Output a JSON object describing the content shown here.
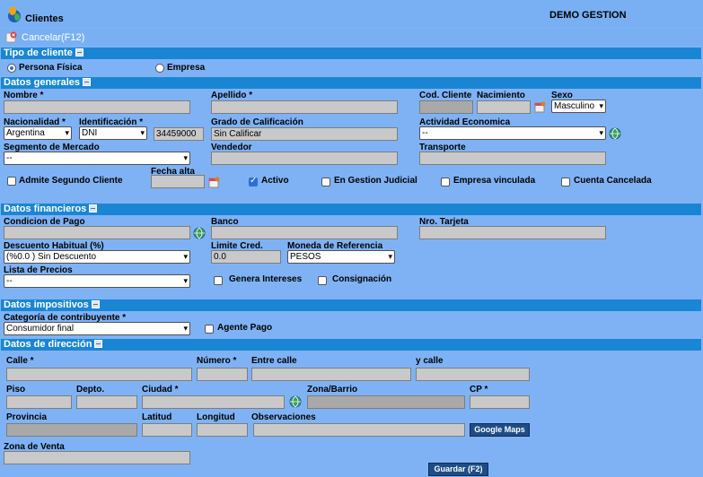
{
  "header": {
    "title": "Clientes",
    "company": "DEMO GESTION",
    "cancel_label": "Cancelar(F12)"
  },
  "tipo": {
    "title": "Tipo de cliente",
    "persona_fisica": "Persona Física",
    "empresa": "Empresa"
  },
  "generales": {
    "title": "Datos generales",
    "nombre_label": "Nombre *",
    "apellido_label": "Apellido *",
    "cod_cliente_label": "Cod. Cliente",
    "nacimiento_label": "Nacimiento",
    "sexo_label": "Sexo",
    "sexo_value": "Masculino",
    "nacionalidad_label": "Nacionalidad *",
    "nacionalidad_value": "Argentina",
    "identificacion_label": "Identificación *",
    "identificacion_tipo": "DNI",
    "identificacion_numero": "34459000",
    "grado_label": "Grado de Calificación",
    "grado_value": "Sin Calificar",
    "actividad_label": "Actividad Economica",
    "actividad_value": "--",
    "segmento_label": "Segmento de Mercado",
    "segmento_value": "--",
    "vendedor_label": "Vendedor",
    "transporte_label": "Transporte",
    "fecha_alta_label": "Fecha alta",
    "admite_label": "Admite Segundo Cliente",
    "activo_label": "Activo",
    "gestion_label": "En Gestion Judicial",
    "empresa_vinc_label": "Empresa vinculada",
    "cuenta_cancel_label": "Cuenta Cancelada"
  },
  "financieros": {
    "title": "Datos financieros",
    "condicion_label": "Condicion de Pago",
    "banco_label": "Banco",
    "tarjeta_label": "Nro. Tarjeta",
    "descuento_label": "Descuento Habitual (%)",
    "descuento_value": "(%0.0 ) Sin Descuento",
    "limite_label": "Limite Cred.",
    "limite_value": "0.0",
    "moneda_label": "Moneda de Referencia",
    "moneda_value": "PESOS",
    "lista_label": "Lista de Precios",
    "lista_value": "--",
    "intereses_label": "Genera Intereses",
    "consignacion_label": "Consignación"
  },
  "impositivos": {
    "title": "Datos impositivos",
    "categoria_label": "Categoría de contribuyente *",
    "categoria_value": "Consumidor final",
    "agente_label": "Agente Pago"
  },
  "direccion": {
    "title": "Datos de dirección",
    "calle_label": "Calle *",
    "numero_label": "Número *",
    "entre_label": "Entre calle",
    "ycalle_label": "y calle",
    "piso_label": "Piso",
    "depto_label": "Depto.",
    "ciudad_label": "Ciudad *",
    "zona_label": "Zona/Barrio",
    "cp_label": "CP *",
    "provincia_label": "Provincia",
    "latitud_label": "Latitud",
    "longitud_label": "Longitud",
    "observaciones_label": "Observaciones",
    "maps_label": "Google Maps",
    "zona_venta_label": "Zona de Venta"
  },
  "footer": {
    "guardar_label": "Guardar (F2)"
  },
  "colors": {
    "background": "#7fb2f5",
    "section_bar": "#1a86d3",
    "button_dark": "#1e4d86"
  }
}
